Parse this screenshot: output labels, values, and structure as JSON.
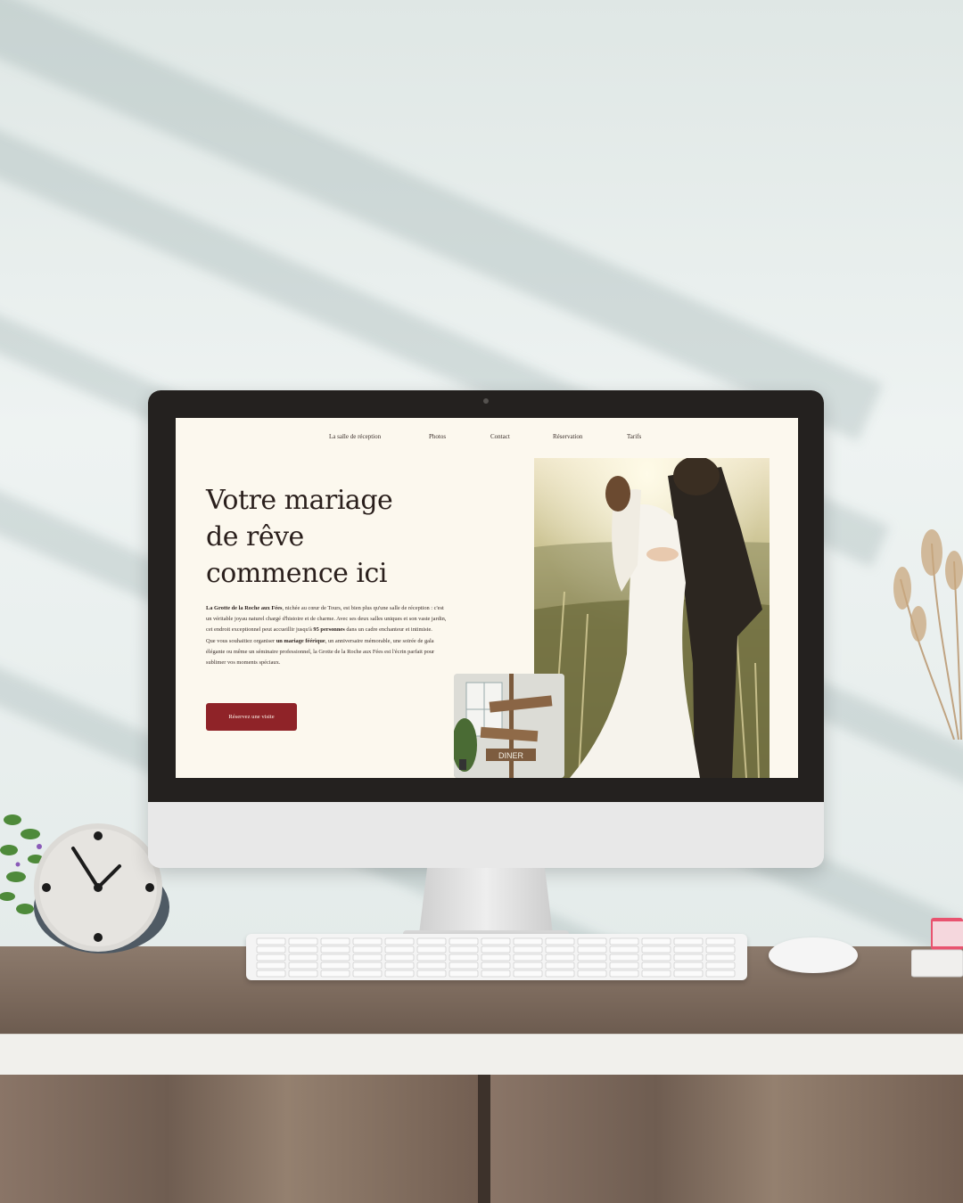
{
  "website": {
    "nav": {
      "items": [
        {
          "label": "La salle de réception"
        },
        {
          "label": "Photos"
        },
        {
          "label": "Contact"
        },
        {
          "label": "Réservation"
        },
        {
          "label": "Tarifs"
        }
      ]
    },
    "hero": {
      "title_line1": "Votre mariage",
      "title_line2": "de rêve",
      "title_line3": "commence ici",
      "p1_bold1": "La Grotte de la Roche aux Fées",
      "p1_text1": ", nichée au cœur de Tours, est bien plus qu'une salle de réception : c'est un véritable joyau naturel chargé d'histoire et de charme. Avec ses deux salles uniques et son vaste jardin, cet endroit exceptionnel peut accueillir jusqu'à ",
      "p1_bold2": "95 personnes",
      "p1_text2": " dans un cadre enchanteur et intimiste.",
      "p2_text1": "Que vous souhaitiez organiser ",
      "p2_bold1": "un mariage féérique",
      "p2_text2": ", un anniversaire mémorable, une soirée de gala élégante ou même un séminaire professionnel, la Grotte de la Roche aux Fées est l'écrin parfait pour sublimer vos moments spéciaux.",
      "cta_label": "Réservez une visite"
    },
    "colors": {
      "background": "#fcf8ee",
      "accent": "#8f2328",
      "text": "#2a1f1c"
    },
    "images": {
      "main": "wedding-couple-photo",
      "small": "wooden-direction-sign-photo"
    },
    "sign_texts": [
      "DINER"
    ]
  },
  "scene": {
    "objects": [
      "desk-clock",
      "keyboard",
      "mouse",
      "potted-plant",
      "dried-pampas",
      "books"
    ]
  }
}
